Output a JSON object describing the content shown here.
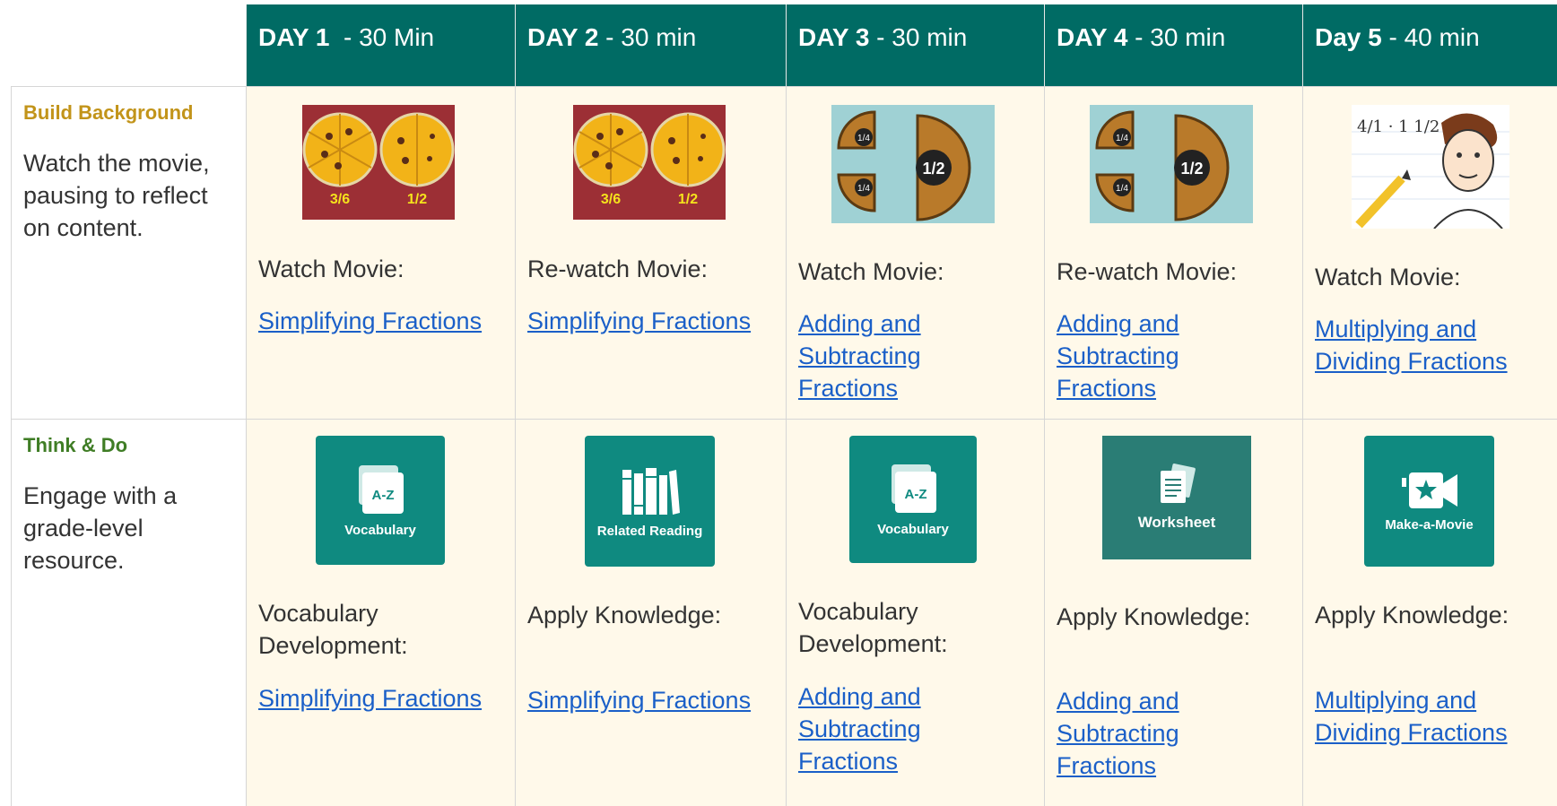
{
  "header": {
    "days": [
      {
        "day": "DAY 1",
        "duration": "  - 30 Min"
      },
      {
        "day": "DAY 2",
        "duration": " - 30 min"
      },
      {
        "day": "DAY 3",
        "duration": " - 30 min"
      },
      {
        "day": "DAY 4",
        "duration": " - 30 min"
      },
      {
        "day": "Day 5",
        "duration": " - 40 min"
      }
    ]
  },
  "rows": {
    "build": {
      "title": "Build Background",
      "description": "Watch the movie, pausing to reflect on content.",
      "cells": [
        {
          "label": "Watch Movie:",
          "link": "Simplifying Fractions"
        },
        {
          "label": "Re-watch Movie:",
          "link": "Simplifying Fractions"
        },
        {
          "label": "Watch Movie:",
          "link": "Adding and Subtracting Fractions"
        },
        {
          "label": "Re-watch Movie:",
          "link": "Adding and Subtracting Fractions"
        },
        {
          "label": "Watch Movie:",
          "link": "Multiplying and Dividing Fractions"
        }
      ],
      "thumb_text": {
        "pizza_left": "3/6",
        "pizza_right": "1/2",
        "quarter": "1/4",
        "half": "1/2",
        "equation": "4/1 · 1 1/2"
      }
    },
    "think": {
      "title": "Think & Do",
      "description": "Engage with a grade-level resource.",
      "cells": [
        {
          "label": "Vocabulary Development:",
          "link": "Simplifying Fractions",
          "tile": "Vocabulary",
          "tile_icon_text": "A-Z"
        },
        {
          "label": "Apply Knowledge:",
          "link": "Simplifying Fractions",
          "tile": "Related Reading"
        },
        {
          "label": "Vocabulary Development:",
          "link": "Adding and Subtracting Fractions",
          "tile": "Vocabulary",
          "tile_icon_text": "A-Z"
        },
        {
          "label": "Apply Knowledge:",
          "link": "Adding and Subtracting Fractions",
          "tile": "Worksheet"
        },
        {
          "label": "Apply Knowledge:",
          "link": "Multiplying and Dividing Fractions",
          "tile": "Make-a-Movie"
        }
      ]
    }
  },
  "colors": {
    "header_bg": "#006b64",
    "cell_bg": "#fff9ea",
    "tile_bg": "#0f8a80",
    "link": "#1a5fc8",
    "build_title": "#c2941a",
    "think_title": "#3f7d25",
    "pizza_bg": "#9c2f35"
  }
}
